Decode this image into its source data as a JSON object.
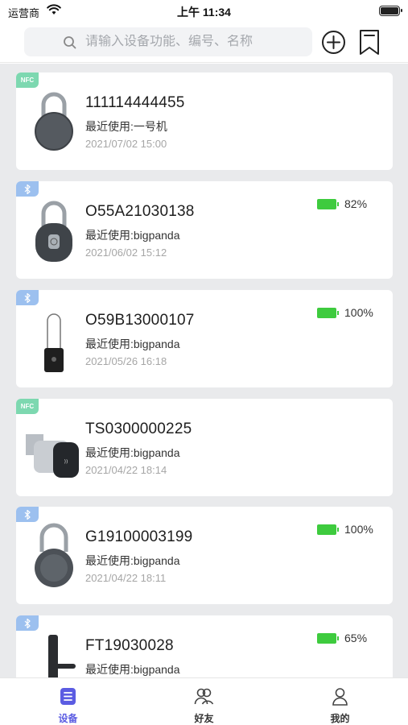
{
  "status_bar": {
    "carrier": "运营商",
    "time": "上午 11:34"
  },
  "search": {
    "placeholder": "请输入设备功能、编号、名称"
  },
  "colors": {
    "accent": "#5b5ce2",
    "nfc_badge": "#7dd8b0",
    "bt_badge": "#9cc0ef",
    "battery": "#3ecb3e"
  },
  "devices": [
    {
      "type": "NFC",
      "icon": "round-padlock-icon",
      "name": "111114444455",
      "user": "最近使用:一号机",
      "time": "2021/07/02 15:00",
      "battery": ""
    },
    {
      "type": "bluetooth",
      "icon": "fingerprint-padlock-icon",
      "name": "O55A21030138",
      "user": "最近使用:bigpanda",
      "time": "2021/06/02 15:12",
      "battery": "82%"
    },
    {
      "type": "bluetooth",
      "icon": "cable-lock-icon",
      "name": "O59B13000107",
      "user": "最近使用:bigpanda",
      "time": "2021/05/26 16:18",
      "battery": "100%"
    },
    {
      "type": "NFC",
      "icon": "cam-lock-icon",
      "name": "TS0300000225",
      "user": "最近使用:bigpanda",
      "time": "2021/04/22 18:14",
      "battery": ""
    },
    {
      "type": "bluetooth",
      "icon": "round-padlock-icon",
      "name": "G19100003199",
      "user": "最近使用:bigpanda",
      "time": "2021/04/22 18:11",
      "battery": "100%"
    },
    {
      "type": "bluetooth",
      "icon": "door-handle-lock-icon",
      "name": "FT19030028",
      "user": "最近使用:bigpanda",
      "time": "",
      "battery": "65%"
    }
  ],
  "tabs": [
    {
      "label": "设备",
      "icon": "device-list-icon",
      "active": true
    },
    {
      "label": "好友",
      "icon": "friends-icon",
      "active": false
    },
    {
      "label": "我的",
      "icon": "profile-icon",
      "active": false
    }
  ]
}
